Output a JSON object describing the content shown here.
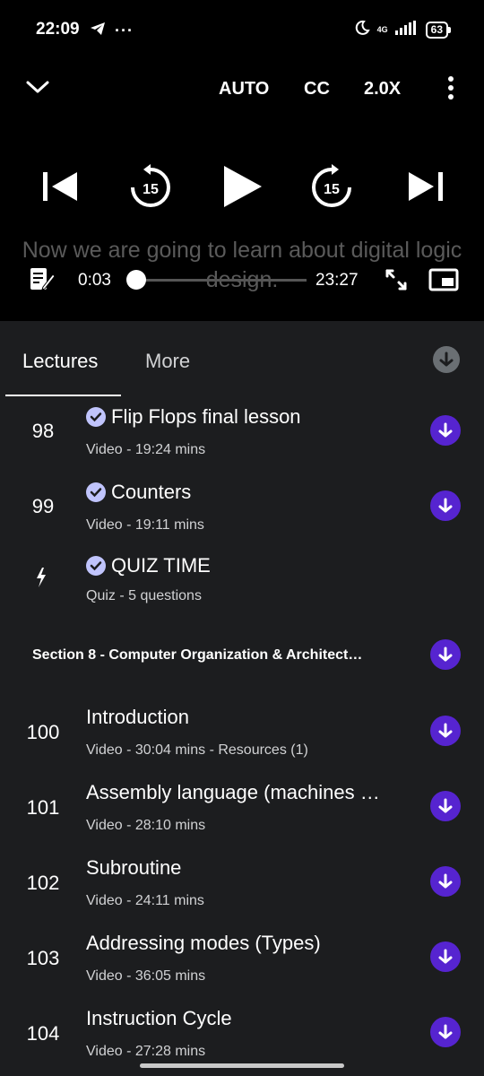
{
  "status_bar": {
    "time": "22:09",
    "network": "4G",
    "battery": "63"
  },
  "player": {
    "quality_label": "AUTO",
    "cc_label": "CC",
    "speed_label": "2.0X",
    "skip_back_seconds": "15",
    "skip_forward_seconds": "15",
    "caption_text": "Now we are going to learn about digital logic design.",
    "current_time": "0:03",
    "duration": "23:27",
    "progress_fraction": 0.002
  },
  "tabs": {
    "lectures": "Lectures",
    "more": "More"
  },
  "lectures_top": [
    {
      "num": "98",
      "title": "Flip Flops final lesson",
      "subtitle": "Video - 19:24 mins",
      "completed": true
    },
    {
      "num": "99",
      "title": "Counters",
      "subtitle": "Video - 19:11 mins",
      "completed": true
    },
    {
      "num": "",
      "title": "QUIZ TIME",
      "subtitle": "Quiz - 5 questions",
      "completed": true,
      "is_quiz": true
    }
  ],
  "section": {
    "title": "Section 8 - Computer Organization & Architect…"
  },
  "lectures": [
    {
      "num": "100",
      "title": "Introduction",
      "subtitle": "Video - 30:04 mins - Resources (1)"
    },
    {
      "num": "101",
      "title": "Assembly language (machines …",
      "subtitle": "Video - 28:10 mins"
    },
    {
      "num": "102",
      "title": "Subroutine",
      "subtitle": "Video - 24:11 mins"
    },
    {
      "num": "103",
      "title": "Addressing modes (Types)",
      "subtitle": "Video - 36:05 mins"
    },
    {
      "num": "104",
      "title": "Instruction Cycle",
      "subtitle": "Video - 27:28 mins"
    }
  ],
  "colors": {
    "accent": "#5624d0",
    "check": "#c0c4fc",
    "background": "#1c1d1f"
  }
}
